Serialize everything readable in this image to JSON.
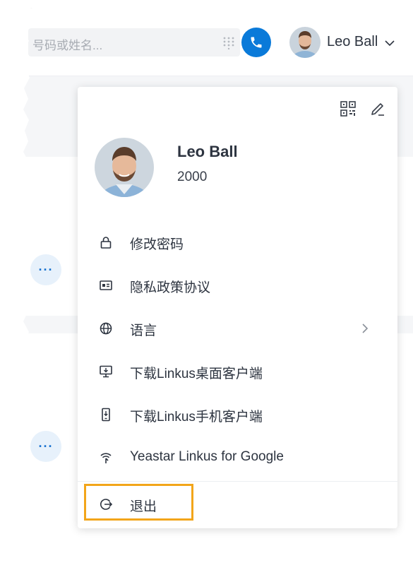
{
  "topbar": {
    "search_placeholder": "号码或姓名...",
    "username": "Leo Ball",
    "icons": {
      "dialpad": "dialpad-icon",
      "call": "phone-icon",
      "chevron": "chevron-down-icon"
    }
  },
  "background": {
    "more_label": "···"
  },
  "profile": {
    "name": "Leo Ball",
    "extension": "2000"
  },
  "menu": {
    "items": [
      {
        "label": "修改密码",
        "icon": "lock-icon"
      },
      {
        "label": "隐私政策协议",
        "icon": "id-card-icon"
      },
      {
        "label": "语言",
        "icon": "globe-icon",
        "has_submenu": true
      },
      {
        "label": "下载Linkus桌面客户端",
        "icon": "desktop-download-icon"
      },
      {
        "label": "下载Linkus手机客户端",
        "icon": "mobile-download-icon"
      },
      {
        "label": "Yeastar Linkus for Google",
        "icon": "extension-icon"
      }
    ],
    "logout_label": "退出"
  },
  "colors": {
    "accent": "#0a7ad9",
    "highlight": "#f2a51a",
    "text": "#2d3440"
  }
}
